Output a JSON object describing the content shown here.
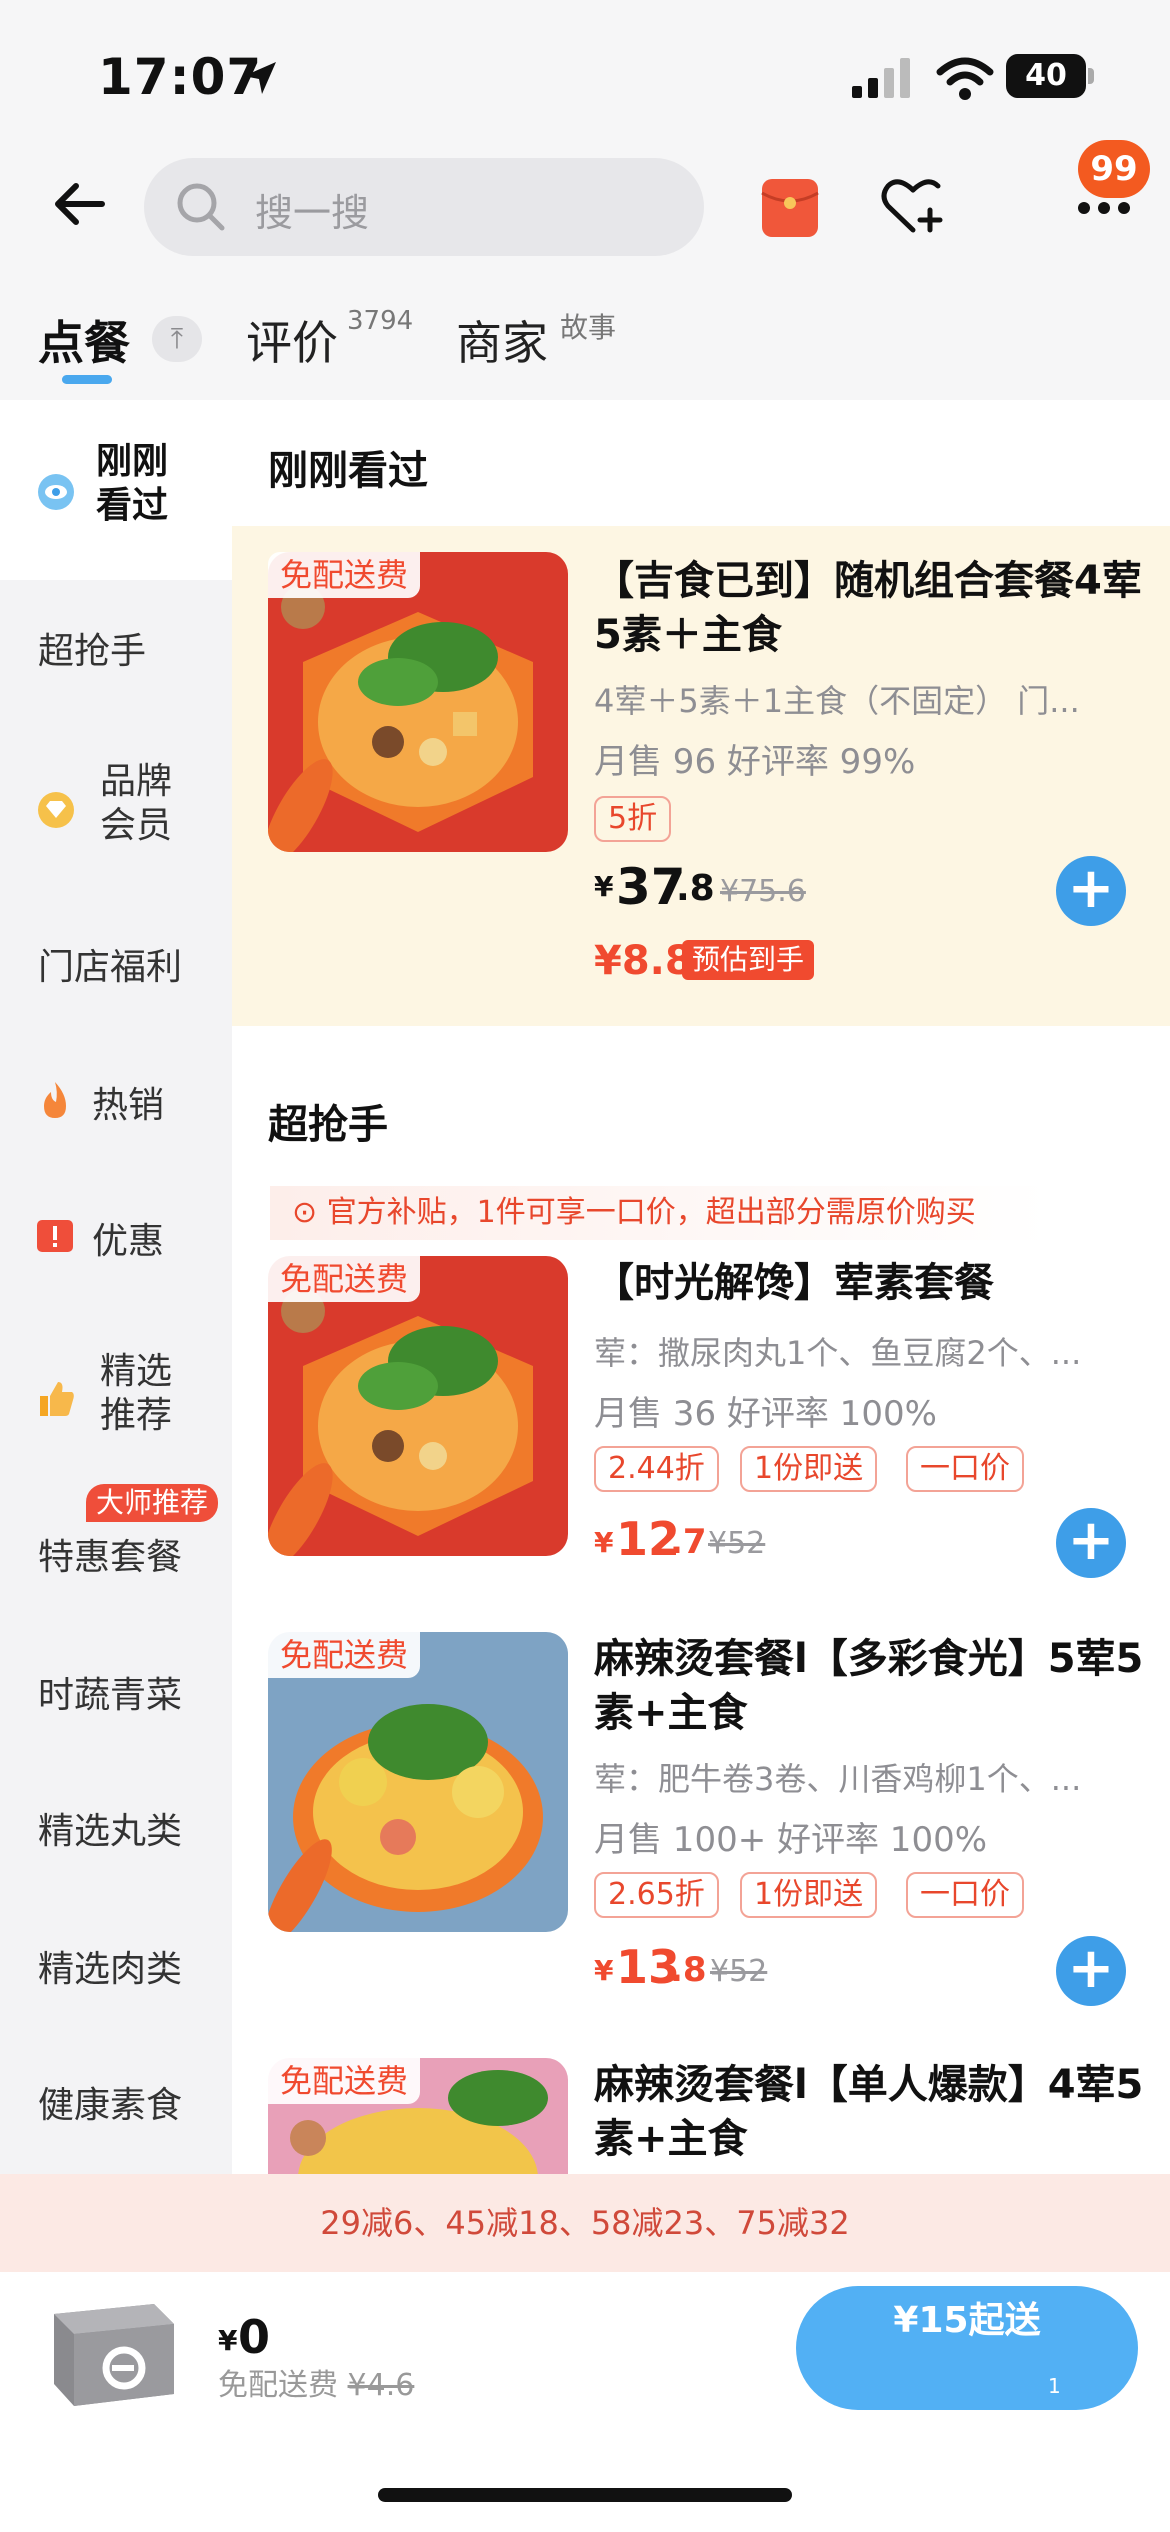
{
  "status_bar": {
    "time": "17:07",
    "battery": "40"
  },
  "header": {
    "search_placeholder": "搜一搜",
    "notification_badge": "99"
  },
  "tabs": {
    "order": "点餐",
    "reviews": "评价",
    "reviews_count": "3794",
    "merchant": "商家",
    "merchant_sup": "故事"
  },
  "sidebar": {
    "items": [
      {
        "line1": "刚刚",
        "line2": "看过",
        "icon": "eye-icon"
      },
      {
        "label": "超抢手"
      },
      {
        "line1": "品牌",
        "line2": "会员",
        "icon": "diamond-icon"
      },
      {
        "label": "门店福利"
      },
      {
        "label": "热销",
        "icon": "flame-icon"
      },
      {
        "label": "优惠",
        "icon": "coupon-icon"
      },
      {
        "line1": "精选",
        "line2": "推荐",
        "icon": "thumbs-up-icon"
      },
      {
        "label": "特惠套餐",
        "tag": "大师推荐"
      },
      {
        "label": "时蔬青菜"
      },
      {
        "label": "精选丸类"
      },
      {
        "label": "精选肉类"
      },
      {
        "label": "健康素食"
      }
    ]
  },
  "sections": {
    "recent": "刚刚看过",
    "hot": "超抢手",
    "subsidy_note": "官方补贴，1件可享一口价，超出部分需原价购买"
  },
  "products": [
    {
      "free_delivery": "免配送费",
      "title": "【吉食已到】随机组合套餐4荤5素＋主食",
      "desc": "4荤＋5素＋1主食（不固定） 门...",
      "sales": "月售 96 好评率 99%",
      "discount": "5折",
      "price_yen": "¥",
      "price_int": "37",
      "price_dec": ".8",
      "price_old": "¥75.6",
      "price_est": "¥8.8",
      "est_label": "预估到手"
    },
    {
      "free_delivery": "免配送费",
      "title": "【时光解馋】荤素套餐",
      "desc": "荤：撒尿肉丸1个、鱼豆腐2个、...",
      "sales": "月售 36 好评率 100%",
      "tags": [
        "2.44折",
        "1份即送",
        "一口价"
      ],
      "price_yen": "¥",
      "price_int": "12",
      "price_dec": ".7",
      "price_old": "¥52"
    },
    {
      "free_delivery": "免配送费",
      "title": "麻辣烫套餐l【多彩食光】5荤5素+主食",
      "desc": "荤：肥牛卷3卷、川香鸡柳1个、...",
      "sales": "月售 100+ 好评率 100%",
      "tags": [
        "2.65折",
        "1份即送",
        "一口价"
      ],
      "price_yen": "¥",
      "price_int": "13",
      "price_dec": ".8",
      "price_old": "¥52"
    },
    {
      "free_delivery": "免配送费",
      "title": "麻辣烫套餐l【单人爆款】4荤5素+主食"
    }
  ],
  "promo": "29减6、45减18、58减23、75减32",
  "cart": {
    "yen": "¥",
    "total": "0",
    "fee_label": "免配送费",
    "fee_old": "¥4.6",
    "checkout": "¥15起送",
    "checkout_small": "1"
  },
  "colors": {
    "accent_blue": "#3e9ee8",
    "price_red": "#f04a2f",
    "highlight": "#fdf6e3"
  }
}
